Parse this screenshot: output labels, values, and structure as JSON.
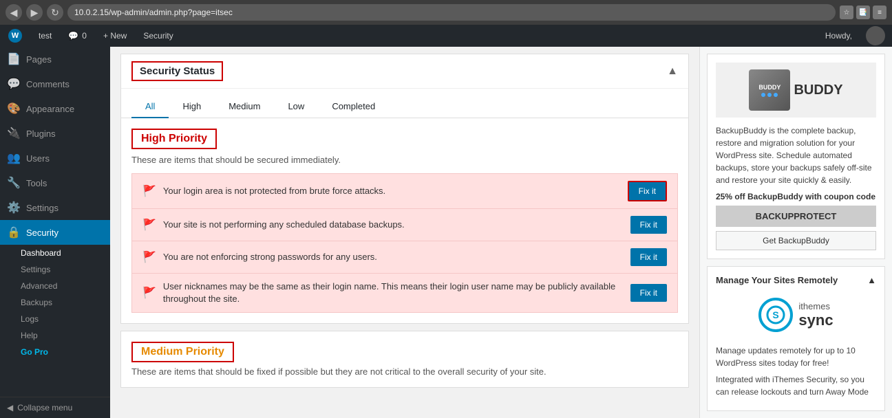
{
  "browser": {
    "url": "10.0.2.15/wp-admin/admin.php?page=itsec",
    "back_icon": "◀",
    "forward_icon": "▶"
  },
  "admin_bar": {
    "wp_logo": "W",
    "site_name": "test",
    "comments_count": "0",
    "new_label": "+ New",
    "security_label": "Security",
    "howdy_label": "Howdy,"
  },
  "sidebar": {
    "pages_label": "Pages",
    "comments_label": "Comments",
    "appearance_label": "Appearance",
    "plugins_label": "Plugins",
    "users_label": "Users",
    "tools_label": "Tools",
    "settings_label": "Settings",
    "security_label": "Security",
    "dashboard_label": "Dashboard",
    "settings_sub_label": "Settings",
    "advanced_sub_label": "Advanced",
    "backups_sub_label": "Backups",
    "logs_sub_label": "Logs",
    "help_sub_label": "Help",
    "go_pro_label": "Go Pro",
    "collapse_label": "Collapse menu"
  },
  "main": {
    "security_status_title": "Security Status",
    "tabs": [
      {
        "label": "All",
        "active": true
      },
      {
        "label": "High"
      },
      {
        "label": "Medium"
      },
      {
        "label": "Low"
      },
      {
        "label": "Completed"
      }
    ],
    "high_priority": {
      "title": "High Priority",
      "description": "These are items that should be secured immediately.",
      "items": [
        {
          "text": "Your login area is not protected from brute force attacks.",
          "fix_label": "Fix it",
          "highlighted": true
        },
        {
          "text": "Your site is not performing any scheduled database backups.",
          "fix_label": "Fix it",
          "highlighted": false
        },
        {
          "text": "You are not enforcing strong passwords for any users.",
          "fix_label": "Fix it",
          "highlighted": false
        },
        {
          "text": "User nicknames may be the same as their login name. This means their login user name may be publicly available throughout the site.",
          "fix_label": "Fix it",
          "highlighted": false
        }
      ]
    },
    "medium_priority": {
      "title": "Medium Priority",
      "description": "These are items that should be fixed if possible but they are not critical to the overall security of your site."
    }
  },
  "right_sidebar": {
    "buddy_logo_text": "BUDDY",
    "buddy_description": "BackupBuddy is the complete backup, restore and migration solution for your WordPress site. Schedule automated backups, store your backups safely off-site and restore your site quickly & easily.",
    "coupon_label": "25% off BackupBuddy with coupon code",
    "coupon_code": "BACKUPPROTECT",
    "get_label": "Get BackupBuddy",
    "manage_title": "Manage Your Sites Remotely",
    "manage_description": "Manage updates remotely for up to 10 WordPress sites today for free!",
    "manage_description2": "Integrated with iThemes Security, so you can release lockouts and turn Away Mode",
    "sync_label": "sync",
    "ithemes_label": "ithemes"
  }
}
